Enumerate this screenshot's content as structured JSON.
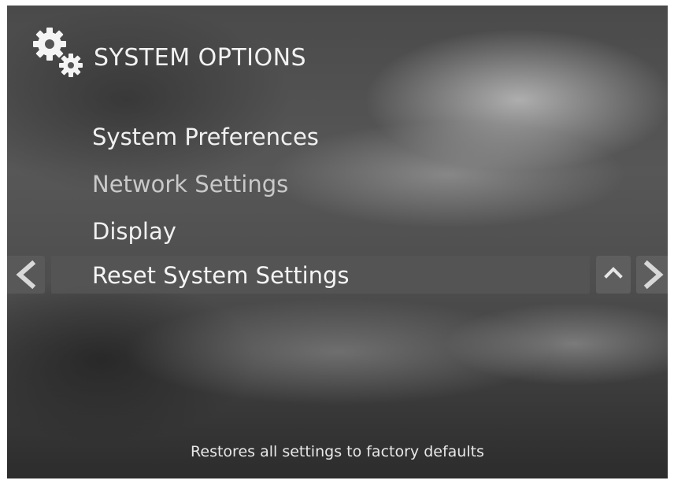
{
  "header": {
    "icon": "gears-icon",
    "title": "SYSTEM OPTIONS"
  },
  "menu": {
    "items": [
      {
        "label": "System Preferences",
        "state": "normal"
      },
      {
        "label": "Network Settings",
        "state": "dimmed"
      },
      {
        "label": "Display",
        "state": "normal"
      },
      {
        "label": "Reset System Settings",
        "state": "selected"
      }
    ]
  },
  "navigation": {
    "left_icon": "chevron-left-icon",
    "up_icon": "chevron-up-icon",
    "right_icon": "chevron-right-icon"
  },
  "footer": {
    "description": "Restores all settings to factory defaults"
  }
}
